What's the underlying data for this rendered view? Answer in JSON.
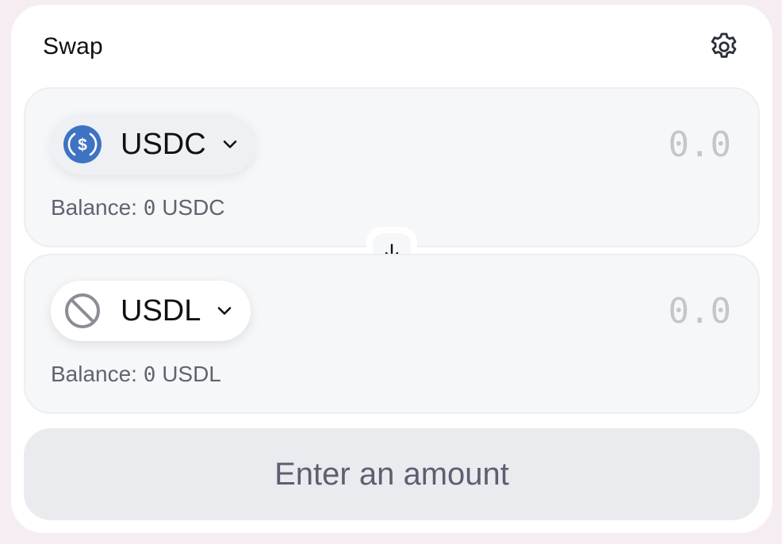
{
  "header": {
    "title": "Swap",
    "settings_icon": "gear-icon"
  },
  "from": {
    "token": {
      "symbol": "USDC",
      "icon": "usdc-logo-icon",
      "color": "#3e73c4"
    },
    "amount": {
      "value": "",
      "placeholder": "0.0"
    },
    "balance": {
      "label": "Balance:",
      "amount": "0",
      "symbol": "USDC"
    }
  },
  "to": {
    "token": {
      "symbol": "USDL",
      "icon": "no-logo-icon",
      "color": "#8a8d95"
    },
    "amount": {
      "value": "",
      "placeholder": "0.0"
    },
    "balance": {
      "label": "Balance:",
      "amount": "0",
      "symbol": "USDL"
    }
  },
  "switch": {
    "icon": "arrow-down-icon"
  },
  "action": {
    "label": "Enter an amount"
  }
}
